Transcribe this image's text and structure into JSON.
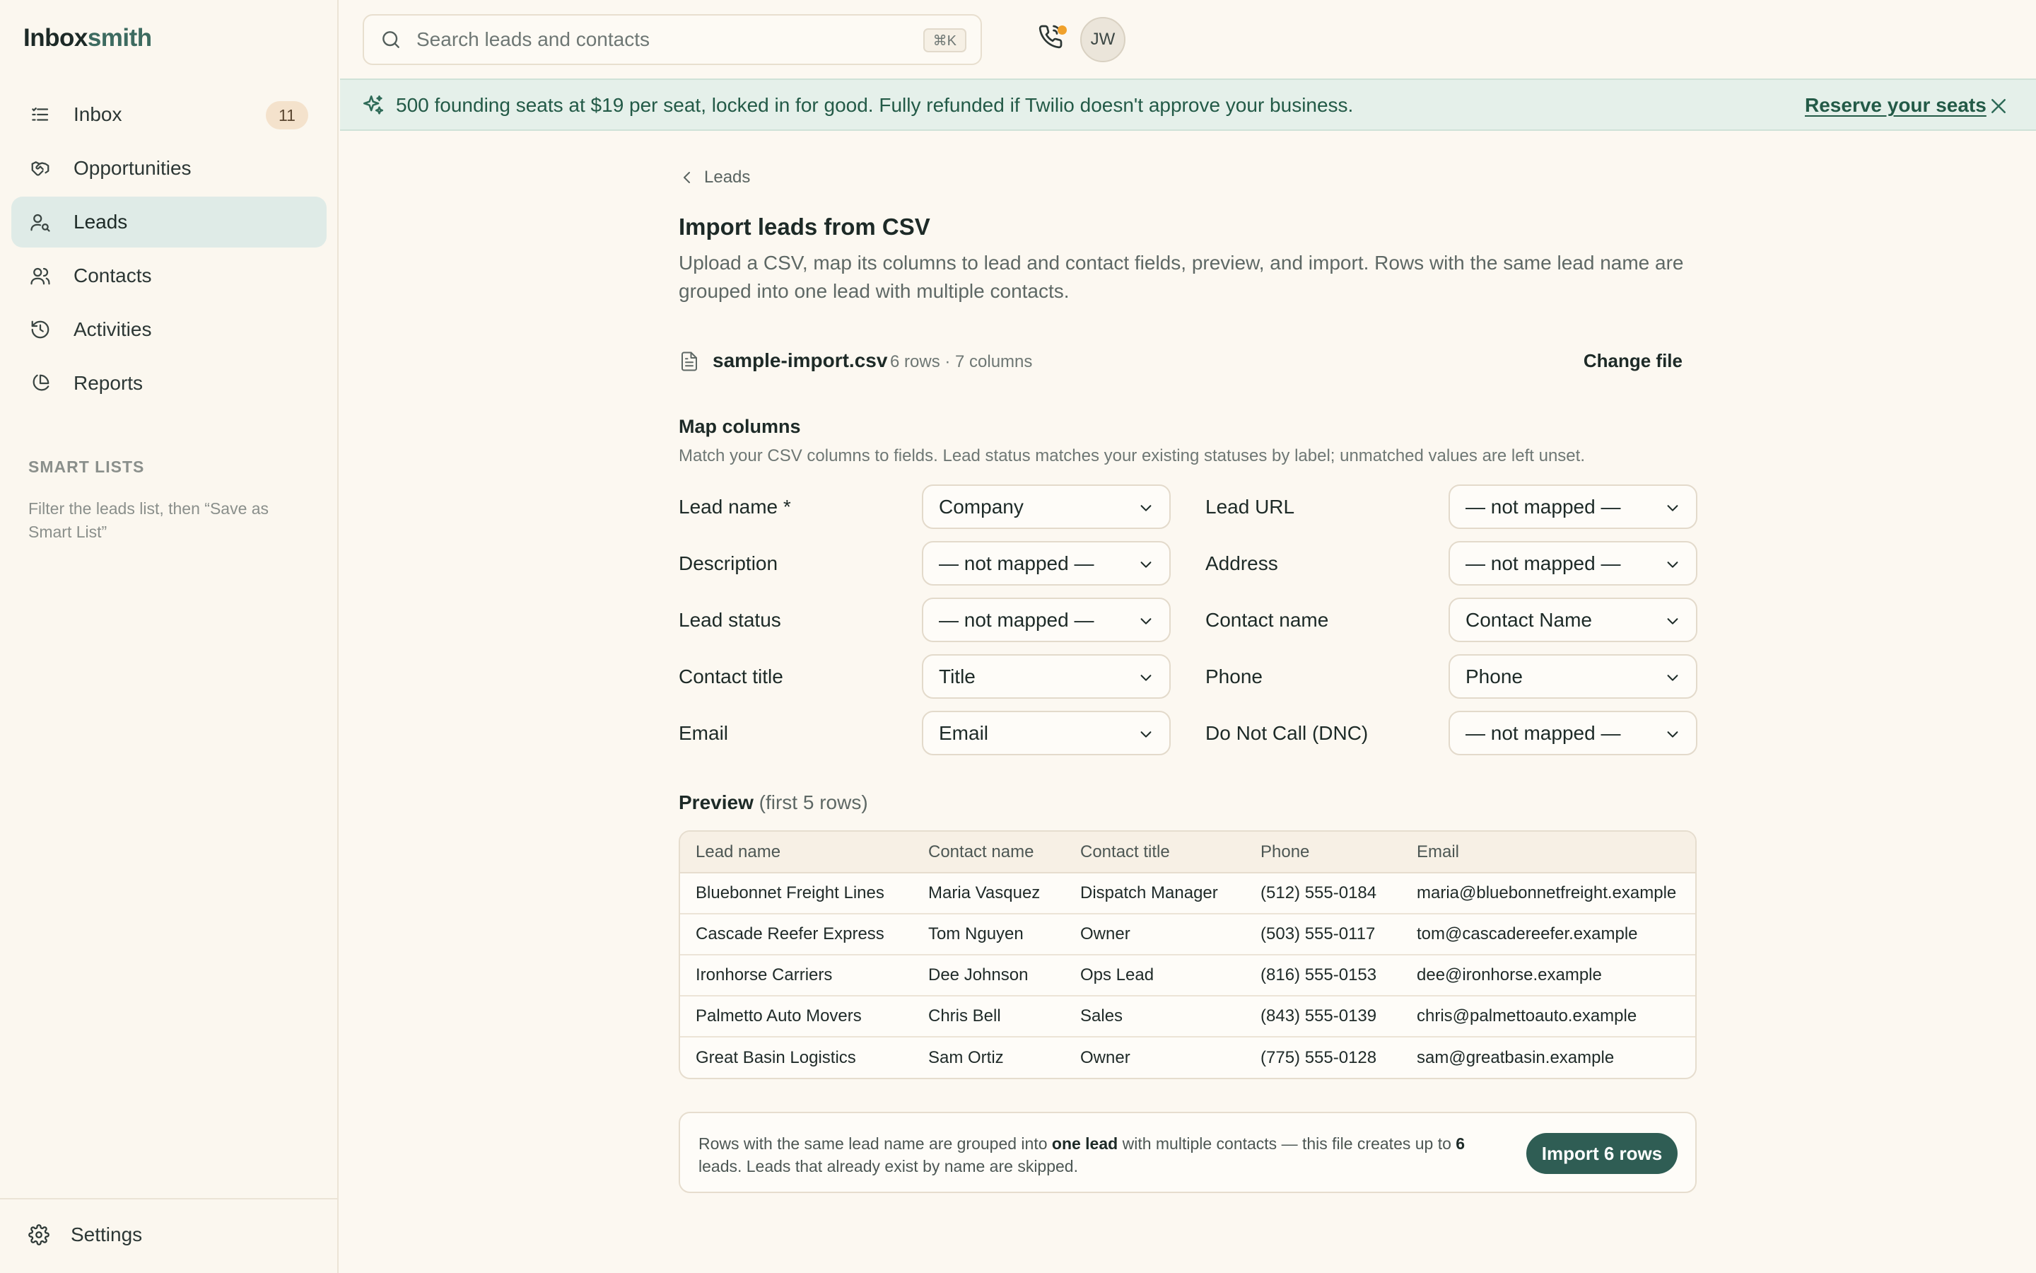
{
  "app": {
    "logo_main": "Inbox",
    "logo_accent": "smith"
  },
  "sidebar": {
    "items": [
      {
        "label": "Inbox",
        "icon": "list-icon",
        "badge": "11",
        "active": false
      },
      {
        "label": "Opportunities",
        "icon": "handshake-icon",
        "active": false
      },
      {
        "label": "Leads",
        "icon": "user-search-icon",
        "active": true
      },
      {
        "label": "Contacts",
        "icon": "users-icon",
        "active": false
      },
      {
        "label": "Activities",
        "icon": "history-icon",
        "active": false
      },
      {
        "label": "Reports",
        "icon": "pie-chart-icon",
        "active": false
      }
    ],
    "smart_lists_title": "SMART LISTS",
    "smart_lists_hint": "Filter the leads list, then “Save as Smart List”",
    "settings_label": "Settings"
  },
  "topbar": {
    "search_placeholder": "Search leads and contacts",
    "search_shortcut": "⌘K",
    "avatar_initials": "JW"
  },
  "banner": {
    "text": "500 founding seats at $19 per seat, locked in for good. Fully refunded if Twilio doesn't approve your business.",
    "link": "Reserve your seats"
  },
  "page": {
    "back_label": "Leads",
    "title": "Import leads from CSV",
    "description": "Upload a CSV, map its columns to lead and contact fields, preview, and import. Rows with the same lead name are grouped into one lead with multiple contacts."
  },
  "file": {
    "name": "sample-import.csv",
    "meta": "6 rows · 7 columns",
    "change_label": "Change file"
  },
  "mapping": {
    "title": "Map columns",
    "subtitle": "Match your CSV columns to fields. Lead status matches your existing statuses by label; unmatched values are left unset.",
    "rows": [
      [
        {
          "label": "Lead name *",
          "value": "Company"
        },
        {
          "label": "Lead URL",
          "value": "— not mapped —"
        }
      ],
      [
        {
          "label": "Description",
          "value": "— not mapped —"
        },
        {
          "label": "Address",
          "value": "— not mapped —"
        }
      ],
      [
        {
          "label": "Lead status",
          "value": "— not mapped —"
        },
        {
          "label": "Contact name",
          "value": "Contact Name"
        }
      ],
      [
        {
          "label": "Contact title",
          "value": "Title"
        },
        {
          "label": "Phone",
          "value": "Phone"
        }
      ],
      [
        {
          "label": "Email",
          "value": "Email"
        },
        {
          "label": "Do Not Call (DNC)",
          "value": "— not mapped —"
        }
      ]
    ]
  },
  "preview": {
    "title": "Preview",
    "subtitle": "(first 5 rows)",
    "columns": [
      "Lead name",
      "Contact name",
      "Contact title",
      "Phone",
      "Email"
    ],
    "rows": [
      [
        "Bluebonnet Freight Lines",
        "Maria Vasquez",
        "Dispatch Manager",
        "(512) 555-0184",
        "maria@bluebonnetfreight.example"
      ],
      [
        "Cascade Reefer Express",
        "Tom Nguyen",
        "Owner",
        "(503) 555-0117",
        "tom@cascadereefer.example"
      ],
      [
        "Ironhorse Carriers",
        "Dee Johnson",
        "Ops Lead",
        "(816) 555-0153",
        "dee@ironhorse.example"
      ],
      [
        "Palmetto Auto Movers",
        "Chris Bell",
        "Sales",
        "(843) 555-0139",
        "chris@palmettoauto.example"
      ],
      [
        "Great Basin Logistics",
        "Sam Ortiz",
        "Owner",
        "(775) 555-0128",
        "sam@greatbasin.example"
      ]
    ]
  },
  "footer": {
    "text_1": "Rows with the same lead name are grouped into ",
    "text_bold_1": "one lead",
    "text_2": " with multiple contacts — this file creates up to ",
    "text_bold_2": "6",
    "text_3": " leads. Leads that already exist by name are skipped.",
    "import_label": "Import 6 rows"
  },
  "colors": {
    "accent": "#2f5d54",
    "banner_bg": "#e5f0ea",
    "active_nav": "#dfebe7",
    "badge_bg": "#f4e2cc",
    "notification_dot": "#f0a12b"
  }
}
